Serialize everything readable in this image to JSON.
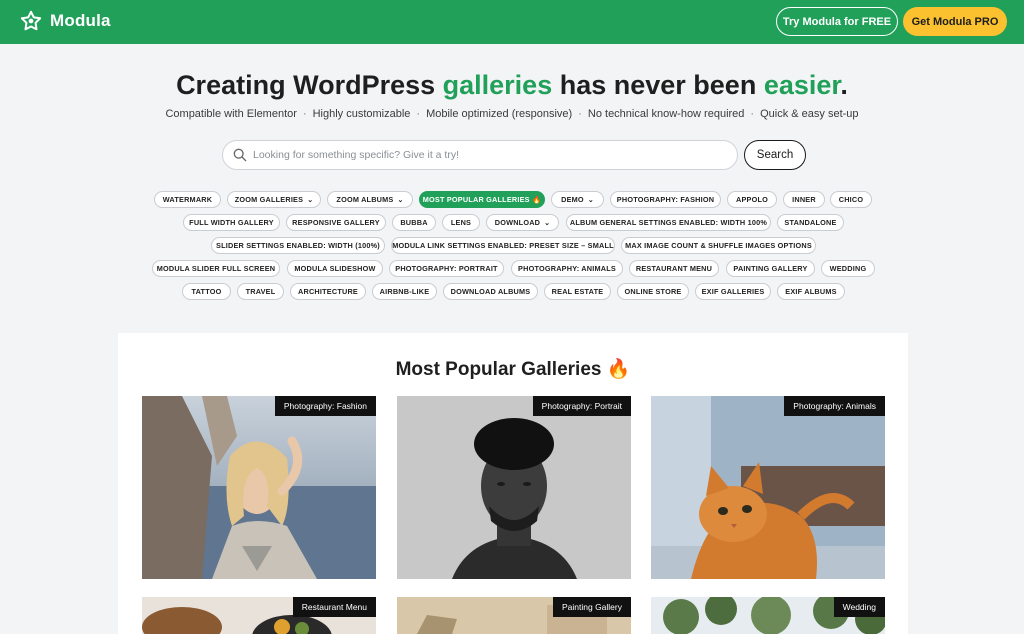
{
  "header": {
    "logo_text": "Modula",
    "try_free_label": "Try Modula for FREE",
    "get_pro_label": "Get Modula PRO",
    "brand_color": "#21a05a",
    "pro_color": "#fcc12e"
  },
  "hero": {
    "title_part1": "Creating WordPress ",
    "title_highlight1": "galleries",
    "title_part2": " has never been ",
    "title_highlight2": "easier",
    "title_part3": ".",
    "features": [
      "Compatible with Elementor",
      "Highly customizable",
      "Mobile optimized (responsive)",
      "No technical know-how required",
      "Quick & easy set-up"
    ]
  },
  "search": {
    "placeholder": "Looking for something specific? Give it a try!",
    "button_label": "Search"
  },
  "tags": [
    "WATERMARK",
    "ZOOM GALLERIES",
    "ZOOM ALBUMS",
    "MOST POPULAR GALLERIES 🔥",
    "DEMO",
    "PHOTOGRAPHY: FASHION",
    "APPOLO",
    "INNER",
    "CHICO",
    "FULL WIDTH GALLERY",
    "RESPONSIVE GALLERY",
    "BUBBA",
    "LENS",
    "DOWNLOAD",
    "ALBUM GENERAL SETTINGS ENABLED: WIDTH 100%",
    "STANDALONE",
    "SLIDER SETTINGS ENABLED: WIDTH (100%)",
    "MODULA LINK SETTINGS ENABLED: PRESET SIZE – SMALL",
    "MAX IMAGE COUNT & SHUFFLE IMAGES OPTIONS",
    "MODULA SLIDER FULL SCREEN",
    "MODULA SLIDESHOW",
    "PHOTOGRAPHY: PORTRAIT",
    "PHOTOGRAPHY: ANIMALS",
    "RESTAURANT MENU",
    "PAINTING GALLERY",
    "WEDDING",
    "TATTOO",
    "TRAVEL",
    "ARCHITECTURE",
    "AIRBNB-LIKE",
    "DOWNLOAD ALBUMS",
    "REAL ESTATE",
    "ONLINE STORE",
    "EXIF GALLERIES",
    "EXIF ALBUMS"
  ],
  "gallery": {
    "section_title": "Most Popular Galleries",
    "section_emoji": "🔥",
    "cards": [
      "Photography: Fashion",
      "Photography: Portrait",
      "Photography: Animals",
      "Restaurant Menu",
      "Painting Gallery",
      "Wedding"
    ]
  }
}
